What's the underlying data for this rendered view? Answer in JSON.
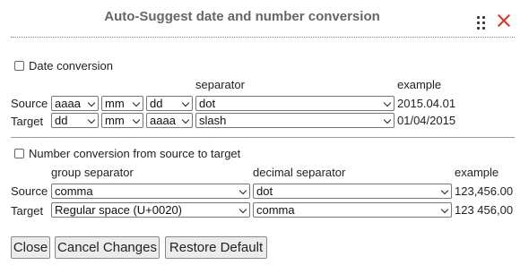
{
  "dialog": {
    "title": "Auto-Suggest date and number conversion"
  },
  "date": {
    "checkbox_label": "Date conversion",
    "checked": false,
    "separator_header": "separator",
    "example_header": "example",
    "source_label": "Source",
    "target_label": "Target",
    "source": {
      "part1": "aaaa",
      "part2": "mm",
      "part3": "dd",
      "separator": "dot",
      "example": "2015.04.01"
    },
    "target": {
      "part1": "dd",
      "part2": "mm",
      "part3": "aaaa",
      "separator": "slash",
      "example": "01/04/2015"
    }
  },
  "number": {
    "checkbox_label": "Number conversion from source to target",
    "checked": false,
    "group_header": "group separator",
    "decimal_header": "decimal separator",
    "example_header": "example",
    "source_label": "Source",
    "target_label": "Target",
    "source": {
      "group": "comma",
      "decimal": "dot",
      "example": "123,456.00"
    },
    "target": {
      "group": "Regular space (U+0020)",
      "decimal": "comma",
      "example": "123 456,00"
    }
  },
  "buttons": {
    "close": "Close",
    "cancel": "Cancel Changes",
    "restore": "Restore Default"
  },
  "colors": {
    "close_x": "#d9352b",
    "title": "#666666"
  }
}
